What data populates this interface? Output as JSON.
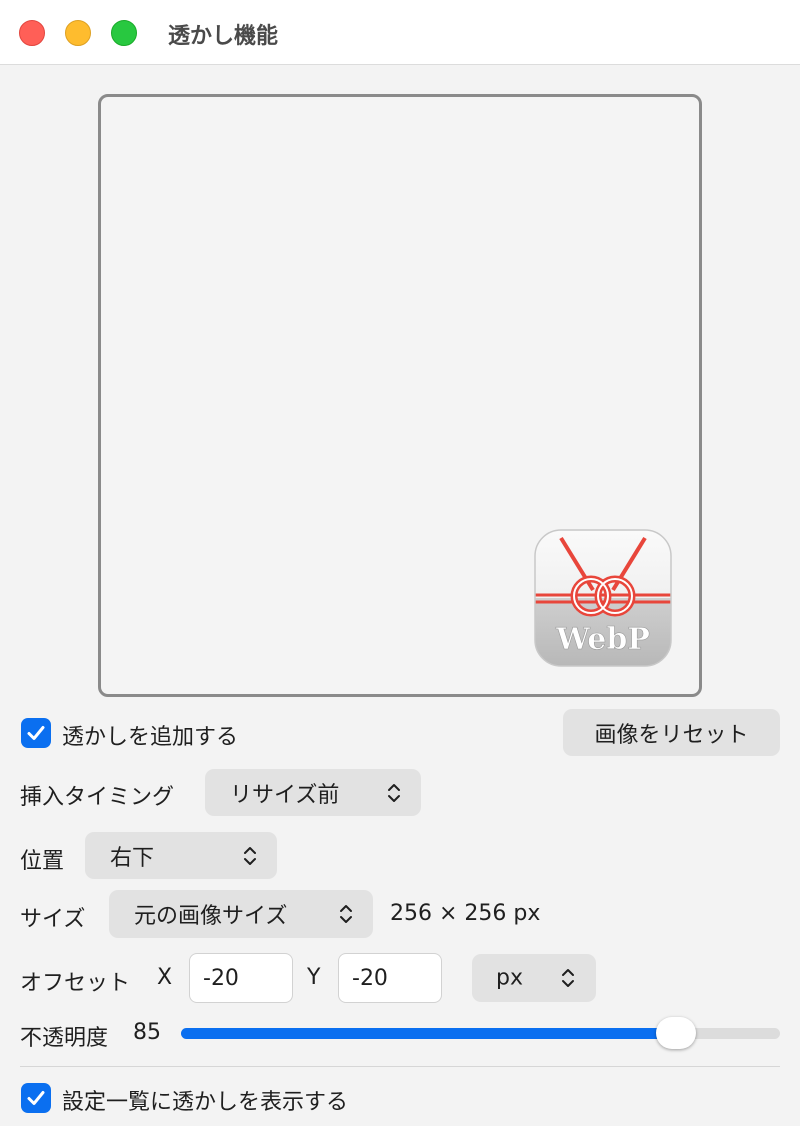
{
  "window": {
    "title": "透かし機能"
  },
  "watermark_preview": {
    "logo_text": "WebP"
  },
  "add_watermark": {
    "label": "透かしを追加する",
    "checked": true
  },
  "reset_button": {
    "label": "画像をリセット"
  },
  "timing": {
    "label": "挿入タイミング",
    "value": "リサイズ前"
  },
  "position": {
    "label": "位置",
    "value": "右下"
  },
  "size": {
    "label": "サイズ",
    "value": "元の画像サイズ",
    "info": "256 × 256 px"
  },
  "offset": {
    "label": "オフセット",
    "x_label": "X",
    "x_value": "-20",
    "y_label": "Y",
    "y_value": "-20",
    "unit": "px"
  },
  "opacity": {
    "label": "不透明度",
    "value": "85",
    "fraction": 0.85
  },
  "show_in_list": {
    "label": "設定一覧に透かしを表示する",
    "checked": true
  },
  "colors": {
    "accent": "#0a6ff0",
    "knot_red": "#e8463b"
  }
}
